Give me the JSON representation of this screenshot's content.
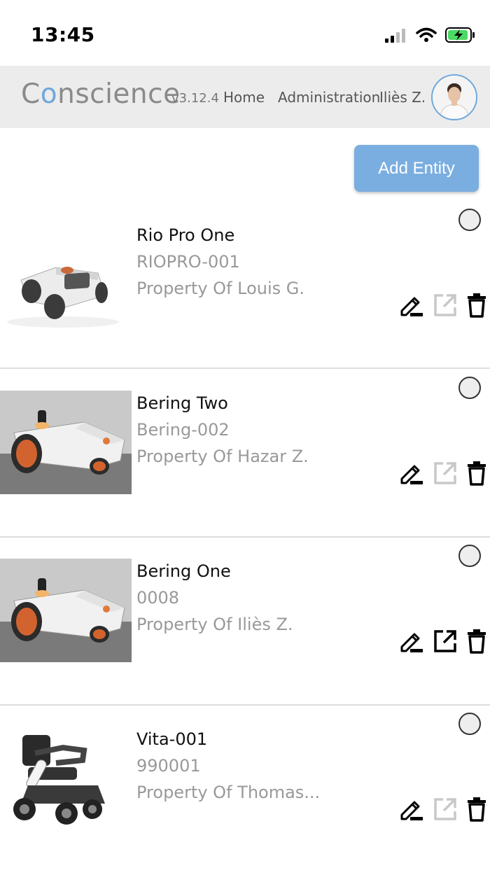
{
  "status_bar": {
    "time": "13:45"
  },
  "header": {
    "brand": "Conscience",
    "version": "v3.12.4",
    "nav": [
      "Home",
      "Administration",
      "Iliès Z."
    ]
  },
  "actions": {
    "add_entity": "Add Entity"
  },
  "entities": [
    {
      "name": "Rio Pro One",
      "serial": "RIOPRO-001",
      "owner": "Property Of Louis G.",
      "open_enabled": false
    },
    {
      "name": "Bering Two",
      "serial": "Bering-002",
      "owner": "Property Of Hazar Z.",
      "open_enabled": false
    },
    {
      "name": "Bering One",
      "serial": "0008",
      "owner": "Property Of Iliès Z.",
      "open_enabled": true
    },
    {
      "name": "Vita-001",
      "serial": "990001",
      "owner": "Property Of Thomas...",
      "open_enabled": false
    }
  ],
  "colors": {
    "accent": "#7baee0",
    "navbar": "#ececec",
    "muted_text": "#999999",
    "disabled_icon": "#c8c8c8"
  }
}
